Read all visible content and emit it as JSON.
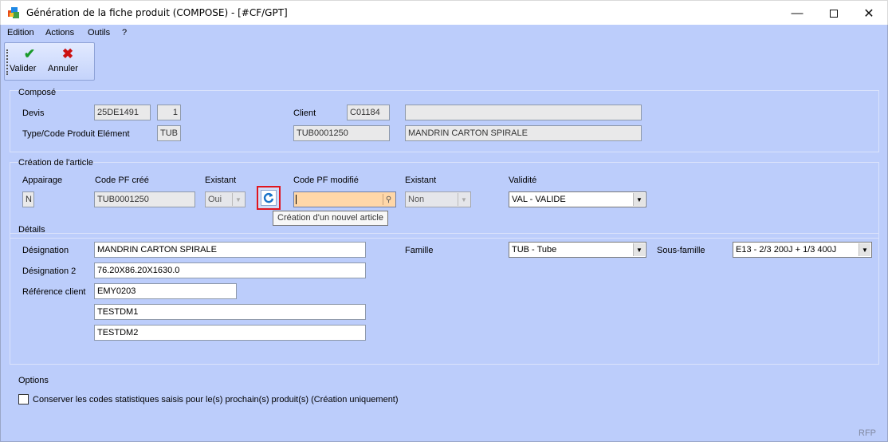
{
  "window": {
    "title": "Génération de la fiche produit (COMPOSE)  -  [#CF/GPT]",
    "minimize_icon": "minimize-icon",
    "maximize_icon": "maximize-icon",
    "close_icon": "close-icon"
  },
  "menu": [
    "Edition",
    "Actions",
    "Outils",
    "?"
  ],
  "toolbar": {
    "validate_label": "Valider",
    "cancel_label": "Annuler",
    "validate_color": "#1a9a2a",
    "cancel_color": "#cc1111"
  },
  "compose": {
    "title": "Composé",
    "devis_label": "Devis",
    "devis_value": "25DE1491",
    "devis_number": "1",
    "client_label": "Client",
    "client_code": "C01184",
    "client_name": "",
    "type_label": "Type/Code Produit Elément",
    "type_value": "TUB",
    "product_code": "TUB0001250",
    "product_name": "MANDRIN CARTON SPIRALE"
  },
  "creation": {
    "title": "Création de l'article",
    "col_appairage": "Appairage",
    "col_code_cree": "Code PF créé",
    "col_existant1": "Existant",
    "col_code_modifie": "Code PF modifié",
    "col_existant2": "Existant",
    "col_validite": "Validité",
    "appairage_value": "N",
    "code_cree_value": "TUB0001250",
    "existant1_value": "Oui",
    "code_modifie_value": "",
    "existant2_value": "Non",
    "validite_value": "VAL - VALIDE",
    "tooltip": "Création d'un nouvel article",
    "highlight_color": "#e0151f",
    "input_highlight_color": "#ffd7a8"
  },
  "details": {
    "title": "Détails",
    "designation_label": "Désignation",
    "designation_value": "MANDRIN CARTON SPIRALE",
    "designation2_label": "Désignation 2",
    "designation2_value": "76.20X86.20X1630.0",
    "ref_client_label": "Référence client",
    "ref_client_value": "EMY0203",
    "extra1_value": "TESTDM1",
    "extra2_value": "TESTDM2",
    "famille_label": "Famille",
    "famille_value": "TUB - Tube",
    "sous_famille_label": "Sous-famille",
    "sous_famille_value": "E13 - 2/3 200J + 1/3 400J"
  },
  "options": {
    "title": "Options",
    "checkbox_label": "Conserver les codes statistiques saisis pour le(s) prochain(s) produit(s) (Création uniquement)",
    "checked": false
  },
  "status": "RFP"
}
